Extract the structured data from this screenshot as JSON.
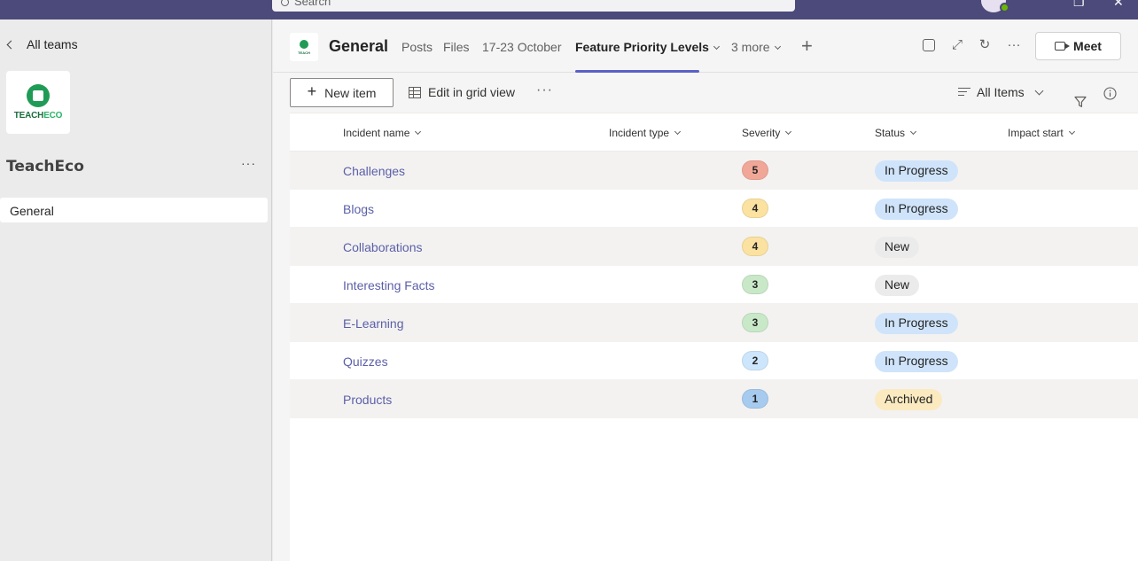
{
  "topbar": {
    "search_placeholder": "Search"
  },
  "left": {
    "back_label": "All teams",
    "team_logo": {
      "teach": "TEACH",
      "eco": "ECO"
    },
    "team_name": "TeachEco",
    "channel": "General"
  },
  "header": {
    "channel_title": "General",
    "tabs": [
      {
        "label": "Posts"
      },
      {
        "label": "Files"
      },
      {
        "label": "17-23 October"
      },
      {
        "label": "Feature Priority Levels"
      },
      {
        "label": "3 more"
      }
    ],
    "meet_label": "Meet"
  },
  "commands": {
    "new_item": "New item",
    "edit_grid": "Edit in grid view",
    "view_label": "All Items"
  },
  "columns": [
    "Incident name",
    "Incident type",
    "Severity",
    "Status",
    "Impact start"
  ],
  "rows": [
    {
      "name": "Challenges",
      "severity": "5",
      "status": "In Progress"
    },
    {
      "name": "Blogs",
      "severity": "4",
      "status": "In Progress"
    },
    {
      "name": "Collaborations",
      "severity": "4",
      "status": "New"
    },
    {
      "name": "Interesting Facts",
      "severity": "3",
      "status": "New"
    },
    {
      "name": "E-Learning",
      "severity": "3",
      "status": "In Progress"
    },
    {
      "name": "Quizzes",
      "severity": "2",
      "status": "In Progress"
    },
    {
      "name": "Products",
      "severity": "1",
      "status": "Archived"
    }
  ],
  "colors": {
    "accent": "#5b5fc7",
    "topbar": "#4b4a7a",
    "severity": {
      "5": "#f1a797",
      "4": "#fbe2a0",
      "3": "#c9e8c8",
      "2": "#cde6fb",
      "1": "#a7cbef"
    },
    "status": {
      "In Progress": "#cfe4fa",
      "New": "#ebebeb",
      "Archived": "#fbeac0"
    }
  }
}
